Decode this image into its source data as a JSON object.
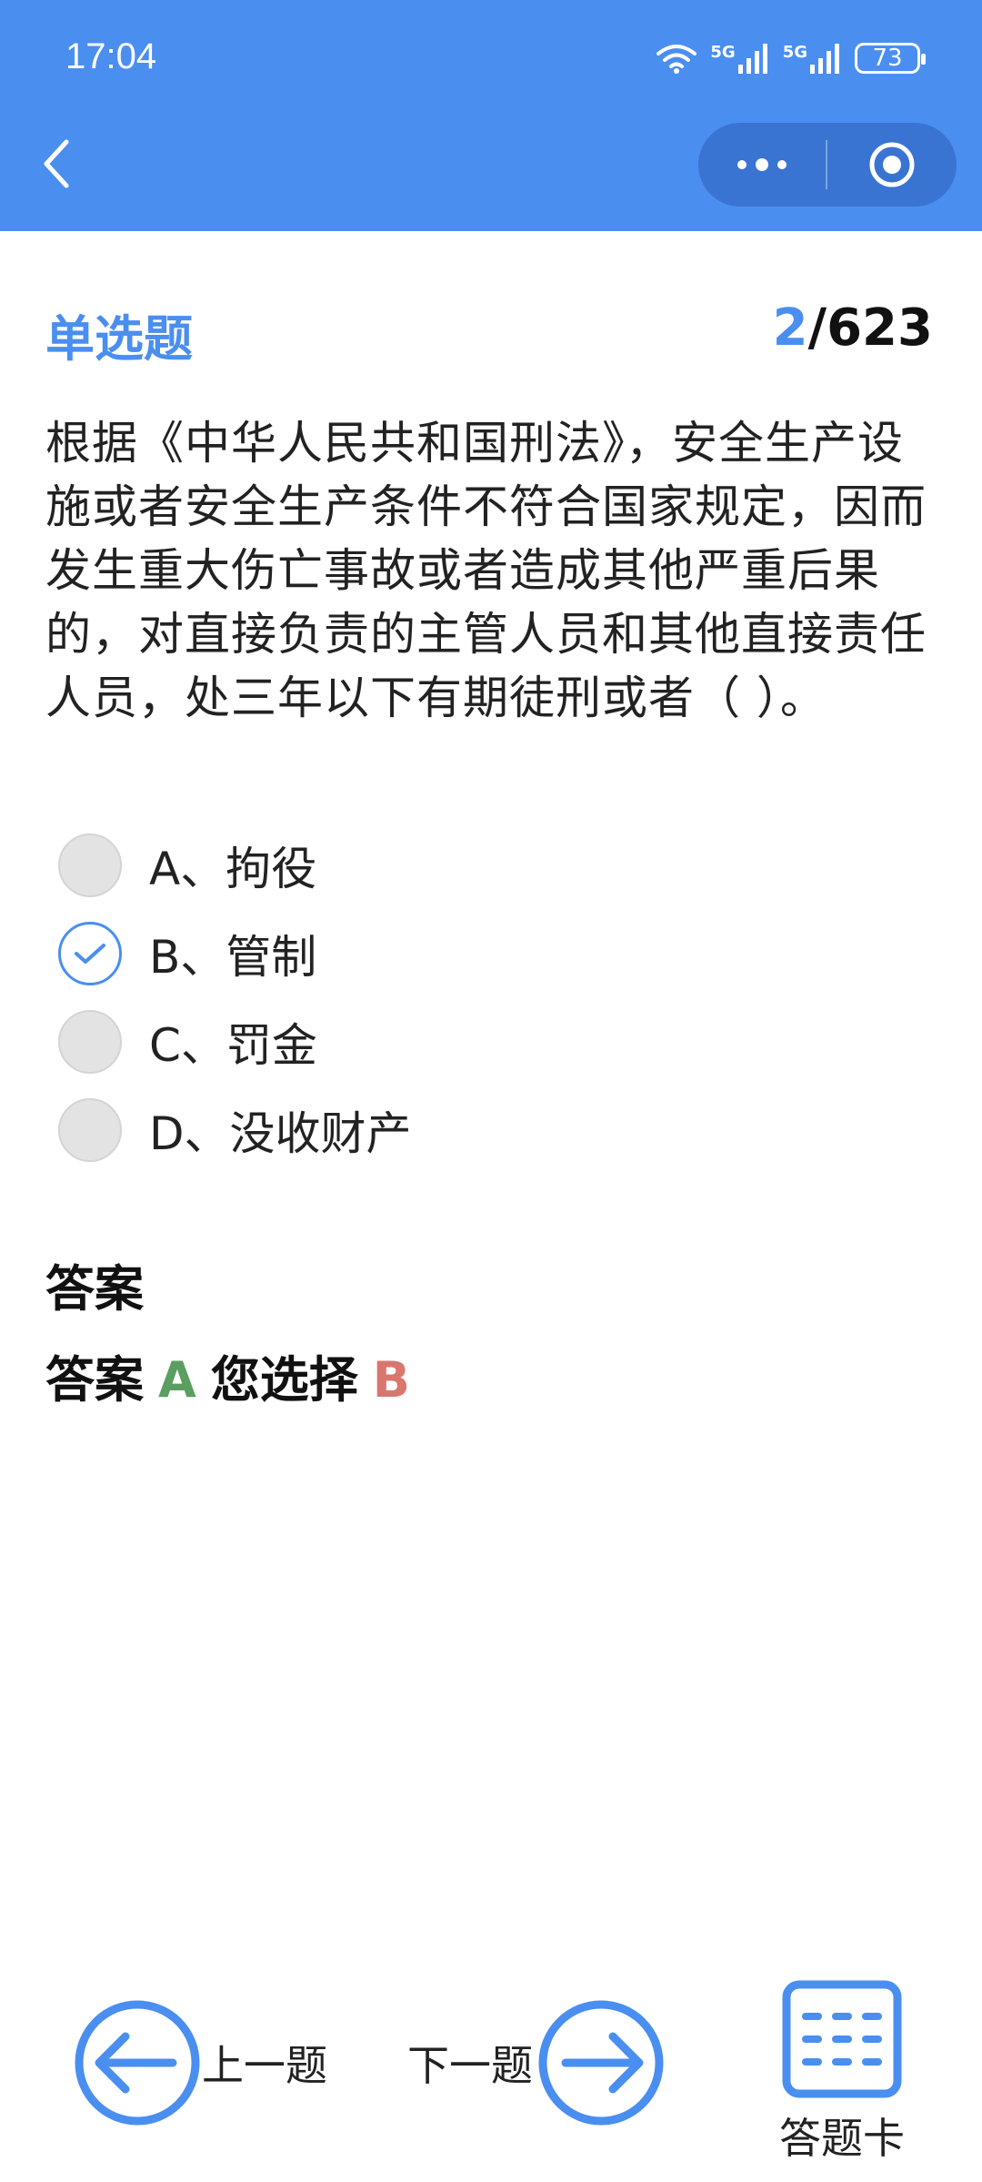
{
  "status_bar": {
    "time": "17:04",
    "battery": "73",
    "network_1": "5G",
    "network_2": "5G"
  },
  "header": {
    "back_icon": "chevron-left-icon",
    "more_icon": "more-dots-icon",
    "target_icon": "target-circle-icon",
    "color": "#4a8ef0"
  },
  "question": {
    "type": "单选题",
    "current": "2",
    "total": "/623",
    "text": "根据《中华人民共和国刑法》，安全生产设施或者安全生产条件不符合国家规定，因而发生重大伤亡事故或者造成其他严重后果的，对直接负责的主管人员和其他直接责任人员，处三年以下有期徒刑或者（ ）。"
  },
  "options": [
    {
      "label": "A、拘役",
      "selected": false
    },
    {
      "label": "B、管制",
      "selected": true
    },
    {
      "label": "C、罚金",
      "selected": false
    },
    {
      "label": "D、没收财产",
      "selected": false
    }
  ],
  "answer": {
    "title": "答案",
    "prefix": "答案",
    "correct": "A",
    "your_choice_label": "您选择",
    "chosen": "B",
    "correct_color": "#5a9e62",
    "chosen_color": "#d9776f"
  },
  "bottom_nav": {
    "prev_label": "上一题",
    "next_label": "下一题",
    "card_label": "答题卡"
  }
}
